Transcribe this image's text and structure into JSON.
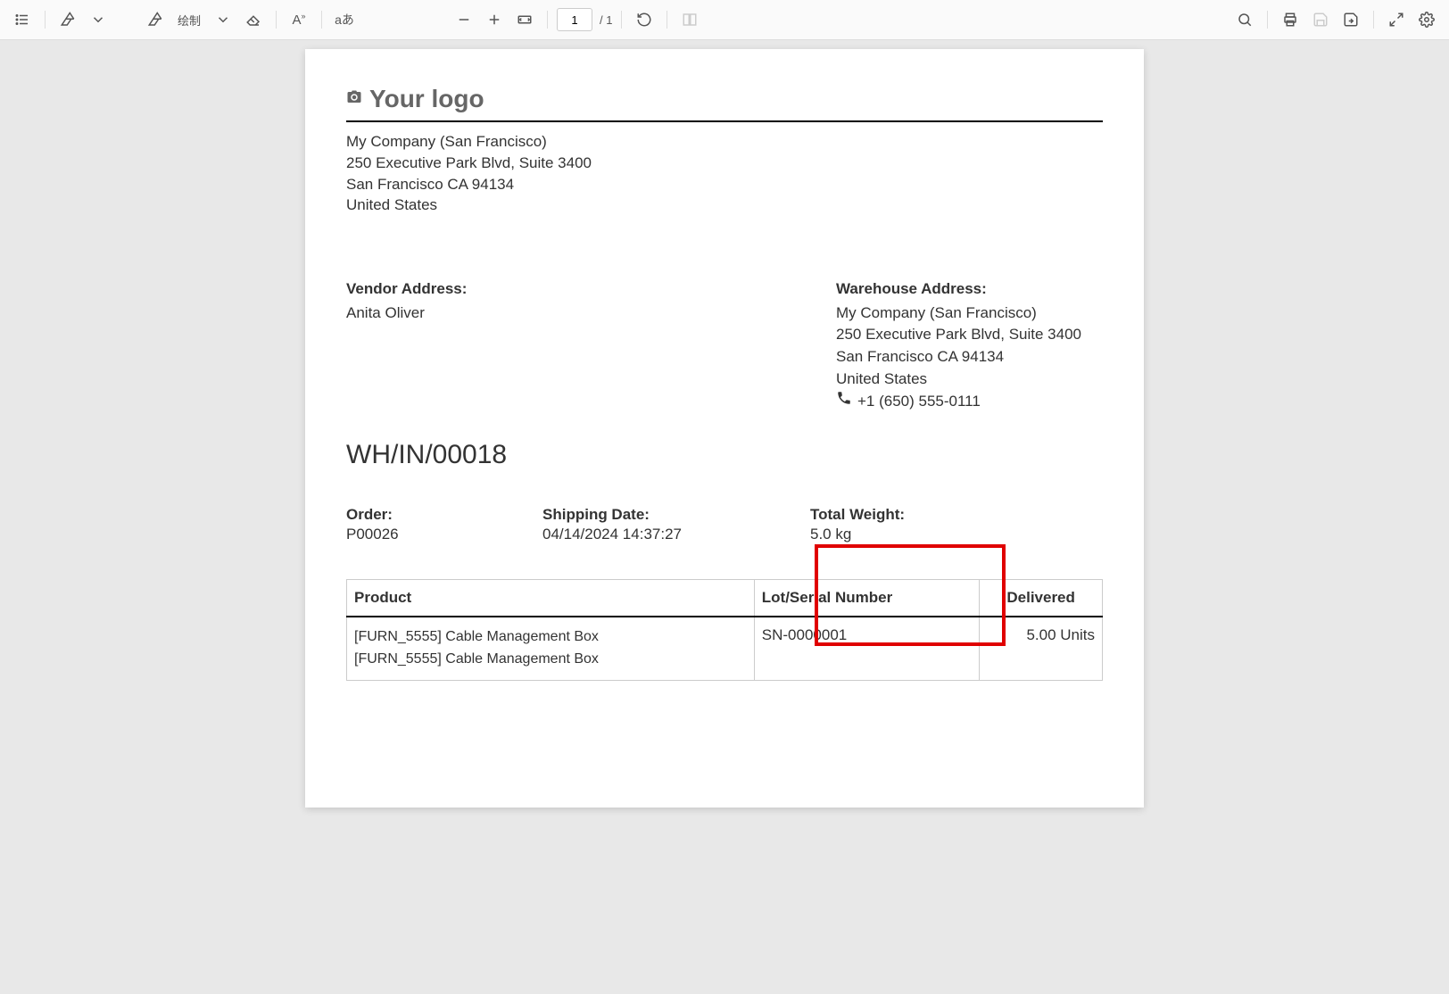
{
  "toolbar": {
    "draw_label": "绘制",
    "page_current": "1",
    "page_total": "/ 1"
  },
  "document": {
    "logo_text": "Your logo",
    "company": {
      "name": "My Company (San Francisco)",
      "street": "250 Executive Park Blvd, Suite 3400",
      "city": "San Francisco CA 94134",
      "country": "United States"
    },
    "vendor": {
      "label": "Vendor Address:",
      "name": "Anita Oliver"
    },
    "warehouse": {
      "label": "Warehouse Address:",
      "name": "My Company (San Francisco)",
      "street": "250 Executive Park Blvd, Suite 3400",
      "city": "San Francisco CA 94134",
      "country": "United States",
      "phone": "+1 (650) 555-0111"
    },
    "doc_number": "WH/IN/00018",
    "meta": {
      "order_label": "Order:",
      "order_value": "P00026",
      "ship_label": "Shipping Date:",
      "ship_value": "04/14/2024 14:37:27",
      "weight_label": "Total Weight:",
      "weight_value": "5.0 kg"
    },
    "table": {
      "headers": {
        "product": "Product",
        "lot": "Lot/Serial Number",
        "delivered": "Delivered"
      },
      "rows": [
        {
          "product_line1": "[FURN_5555] Cable Management Box",
          "product_line2": "[FURN_5555] Cable Management Box",
          "lot": "SN-0000001",
          "delivered": "5.00 Units"
        }
      ]
    }
  }
}
